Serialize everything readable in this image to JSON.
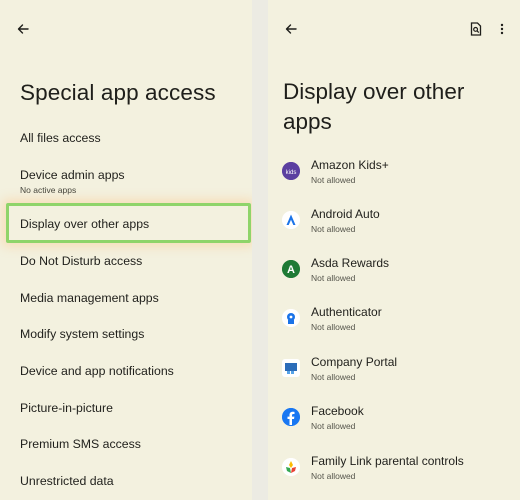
{
  "left": {
    "title": "Special app access",
    "items": [
      {
        "label": "All files access"
      },
      {
        "label": "Device admin apps",
        "sub": "No active apps"
      },
      {
        "label": "Display over other apps"
      },
      {
        "label": "Do Not Disturb access"
      },
      {
        "label": "Media management apps"
      },
      {
        "label": "Modify system settings"
      },
      {
        "label": "Device and app notifications"
      },
      {
        "label": "Picture-in-picture"
      },
      {
        "label": "Premium SMS access"
      },
      {
        "label": "Unrestricted data"
      }
    ]
  },
  "right": {
    "title_line1": "Display over other",
    "title_line2": "apps",
    "apps": [
      {
        "name": "Amazon Kids+",
        "status": "Not allowed",
        "icon": "amazon-kids-icon",
        "color": "#5b3fa0"
      },
      {
        "name": "Android Auto",
        "status": "Not allowed",
        "icon": "android-auto-icon",
        "color": "#1a73e8"
      },
      {
        "name": "Asda Rewards",
        "status": "Not allowed",
        "icon": "asda-rewards-icon",
        "color": "#1e7a35"
      },
      {
        "name": "Authenticator",
        "status": "Not allowed",
        "icon": "authenticator-icon",
        "color": "#1a73e8"
      },
      {
        "name": "Company Portal",
        "status": "Not allowed",
        "icon": "company-portal-icon",
        "color": "#2b6cb8"
      },
      {
        "name": "Facebook",
        "status": "Not allowed",
        "icon": "facebook-icon",
        "color": "#1877f2"
      },
      {
        "name": "Family Link parental controls",
        "status": "Not allowed",
        "icon": "family-link-icon",
        "color": "#34a853"
      }
    ]
  }
}
